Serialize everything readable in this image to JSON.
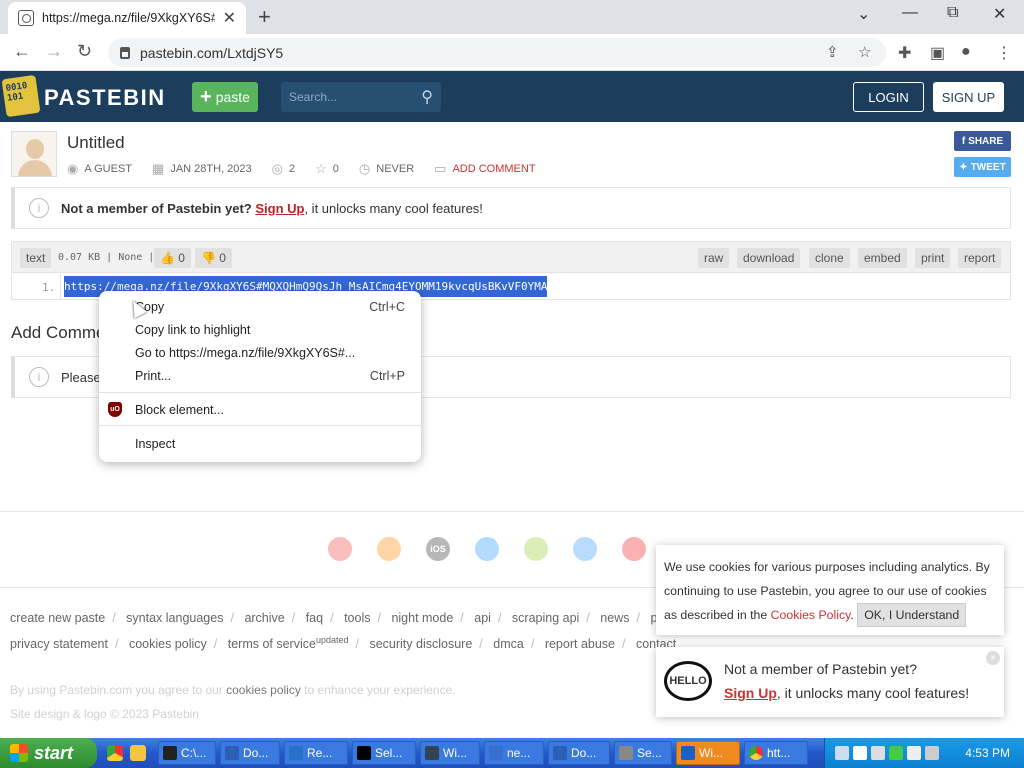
{
  "browser": {
    "tab_title": "https://mega.nz/file/9XkgXY6S#M",
    "new_tab": "+",
    "url": "pastebin.com/LxtdjSY5",
    "win_min": "⌄",
    "win_minimize": "—",
    "win_restore": "⧉",
    "win_close": "✕",
    "back": "←",
    "forward": "→",
    "reload": "↻"
  },
  "header": {
    "logo_text": "0010 101",
    "brand": "PASTEBIN",
    "paste_label": "paste",
    "search_placeholder": "Search...",
    "login": "LOGIN",
    "signup": "SIGN UP"
  },
  "paste": {
    "title": "Untitled",
    "author": "A GUEST",
    "date": "JAN 28TH, 2023",
    "views": "2",
    "stars": "0",
    "expires": "NEVER",
    "add_comment": "ADD COMMENT",
    "share": "SHARE",
    "tweet": "TWEET"
  },
  "notice": {
    "prefix": "Not a member of Pastebin yet?",
    "link": "Sign Up",
    "suffix": ", it unlocks many cool features!"
  },
  "codebar": {
    "syntax": "text",
    "info": "0.07 KB | None |",
    "likes": "0",
    "dislikes": "0",
    "buttons": [
      "raw",
      "download",
      "clone",
      "embed",
      "print",
      "report"
    ]
  },
  "code": {
    "line_no": "1.",
    "text": "https://mega.nz/file/9XkgXY6S#MQXQHmQ9QsJh_MsAICmg4EYOMM19kvcqUsBKvVF0YMA"
  },
  "add_comment_heading": "Add Comme",
  "comment_notice": "Please,",
  "context_menu": {
    "copy": "Copy",
    "copy_shortcut": "Ctrl+C",
    "copy_link": "Copy link to highlight",
    "goto": "Go to https://mega.nz/file/9XkgXY6S#...",
    "print": "Print...",
    "print_shortcut": "Ctrl+P",
    "block": "Block element...",
    "ublock_badge": "uO",
    "inspect": "Inspect"
  },
  "platforms": [
    "chrome",
    "firefox",
    "iOS",
    "windows",
    "android",
    "mac",
    "opera"
  ],
  "footer": {
    "row1": [
      "create new paste",
      "syntax languages",
      "archive",
      "faq",
      "tools",
      "night mode",
      "api",
      "scraping api",
      "news",
      "pro"
    ],
    "row2_a": [
      "privacy statement",
      "cookies policy"
    ],
    "terms": "terms of service",
    "updated": "updated",
    "row2_b": [
      "security disclosure",
      "dmca",
      "report abuse",
      "contact"
    ],
    "line1_prefix": "By using Pastebin.com you agree to our ",
    "line1_link": "cookies policy",
    "line1_suffix": " to enhance your experience.",
    "line2": "Site design & logo © 2023 Pastebin"
  },
  "cookie": {
    "text": "We use cookies for various purposes including analytics. By continuing to use Pastebin, you agree to our use of cookies as described in the ",
    "link": "Cookies Policy",
    "after": ". ",
    "button": "OK, I Understand"
  },
  "member_popup": {
    "hello": "HELLO",
    "line1": "Not a member of Pastebin yet?",
    "link": "Sign Up",
    "line2": ", it unlocks many cool features!",
    "close": "×"
  },
  "taskbar": {
    "start": "start",
    "items": [
      "C:\\...",
      "Do...",
      "Re...",
      "Sel...",
      "Wi...",
      "ne...",
      "Do...",
      "Se...",
      "Wi...",
      "htt..."
    ],
    "clock": "4:53 PM"
  }
}
